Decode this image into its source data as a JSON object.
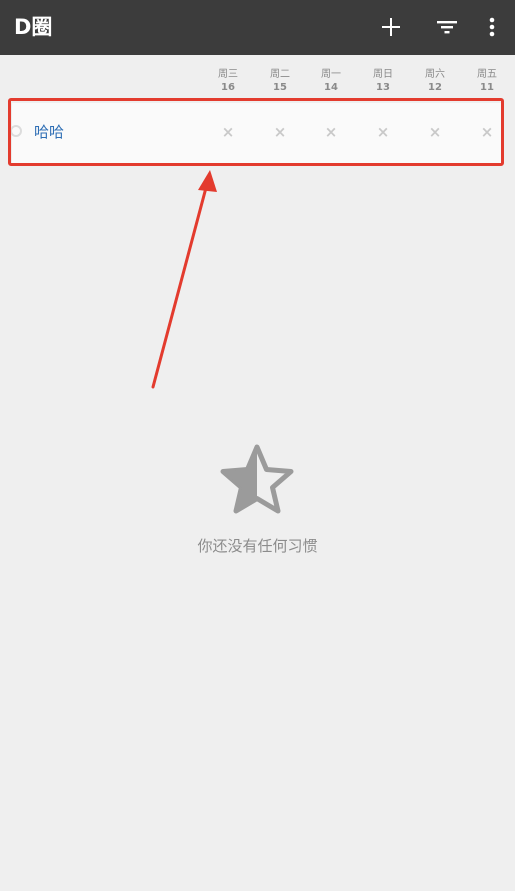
{
  "app_bar": {
    "title": "D圈",
    "icons": [
      "add-icon",
      "filter-icon",
      "more-vertical-icon"
    ]
  },
  "days": [
    {
      "weekday": "周三",
      "date": "16"
    },
    {
      "weekday": "周二",
      "date": "15"
    },
    {
      "weekday": "周一",
      "date": "14"
    },
    {
      "weekday": "周日",
      "date": "13"
    },
    {
      "weekday": "周六",
      "date": "12"
    },
    {
      "weekday": "周五",
      "date": "11"
    }
  ],
  "habit": {
    "name": "哈哈",
    "marks": [
      "×",
      "×",
      "×",
      "×",
      "×",
      "×"
    ]
  },
  "empty_state": {
    "icon": "half-star-icon",
    "message": "你还没有任何习惯"
  },
  "colors": {
    "app_bar": "#3c3c3c",
    "habit_name": "#2f6fb5",
    "highlight": "#e33b2e",
    "background": "#efefef"
  }
}
